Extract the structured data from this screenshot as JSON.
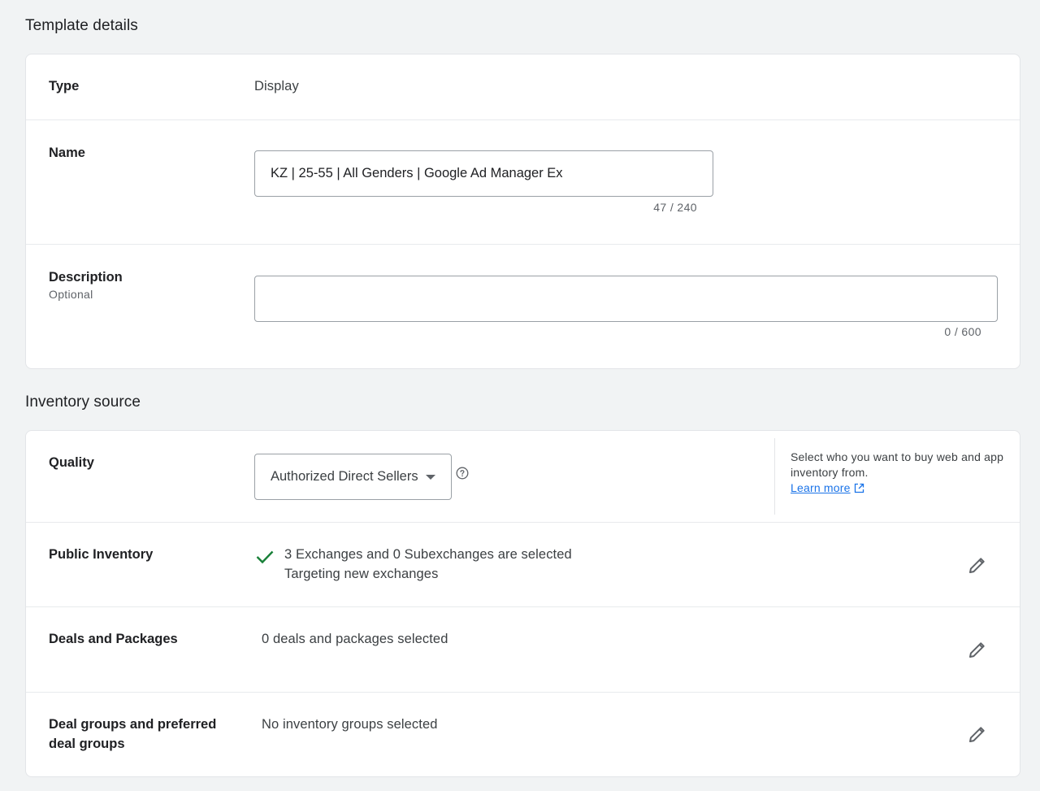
{
  "template_details": {
    "title": "Template details",
    "type": {
      "label": "Type",
      "value": "Display"
    },
    "name": {
      "label": "Name",
      "value": "KZ | 25-55 | All Genders | Google Ad Manager Ex",
      "counter": "47 / 240"
    },
    "description": {
      "label": "Description",
      "sublabel": "Optional",
      "value": "",
      "counter": "0 / 600"
    }
  },
  "inventory_source": {
    "title": "Inventory source",
    "quality": {
      "label": "Quality",
      "selected": "Authorized Direct Sellers",
      "help_text": "Select who you want to buy web and app inventory from.",
      "learn_more": "Learn more"
    },
    "public_inventory": {
      "label": "Public Inventory",
      "line1": "3 Exchanges and 0 Subexchanges are selected",
      "line2": "Targeting new exchanges"
    },
    "deals": {
      "label": "Deals and Packages",
      "value": "0 deals and packages selected"
    },
    "deal_groups": {
      "label": "Deal groups and preferred deal groups",
      "value": "No inventory groups selected"
    }
  },
  "colors": {
    "background": "#f1f3f4",
    "link": "#1a73e8",
    "check": "#188038"
  }
}
